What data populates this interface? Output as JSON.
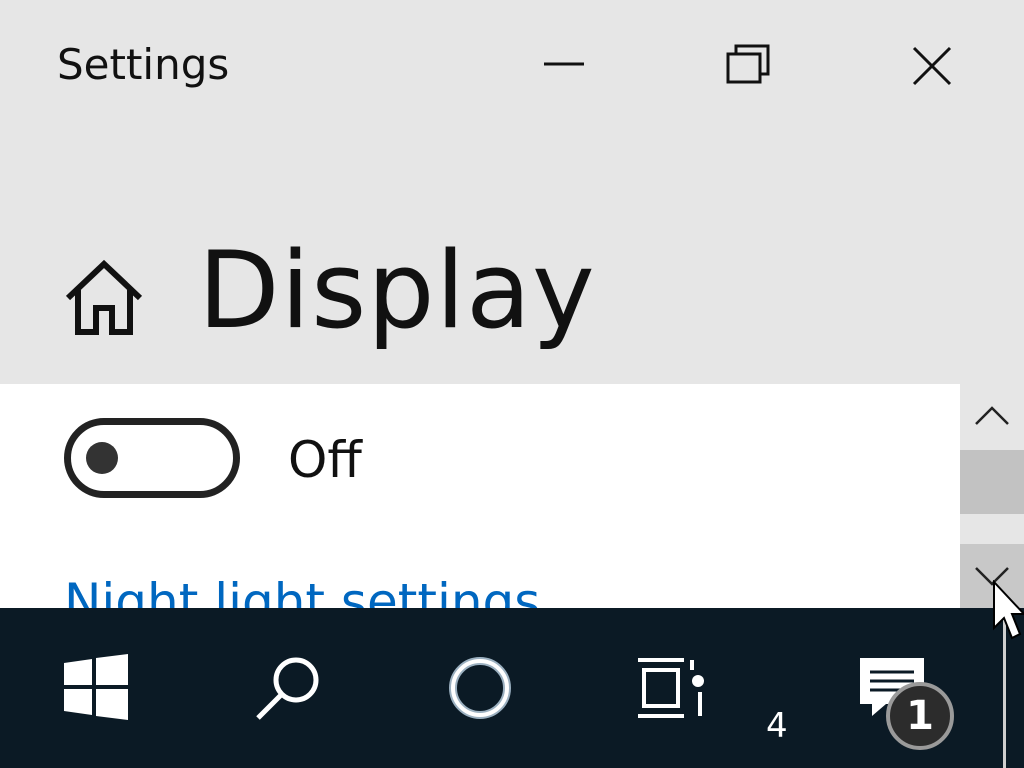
{
  "window": {
    "title": "Settings",
    "controls": {
      "minimize": "minimize-icon",
      "maximize": "restore-icon",
      "close": "close-icon"
    }
  },
  "page": {
    "home_icon": "home-icon",
    "title": "Display"
  },
  "night_light": {
    "toggle_state": "Off",
    "link": "Night light settings"
  },
  "scrollbar": {
    "up_icon": "chevron-up-icon",
    "down_icon": "chevron-down-icon"
  },
  "taskbar": {
    "items": [
      "windows-start-icon",
      "search-icon",
      "cortana-icon",
      "task-view-icon",
      "action-center-icon"
    ],
    "notification_badge": "1",
    "small_text": "4"
  },
  "colors": {
    "link": "#0067c0",
    "taskbar_bg": "#0b1a25",
    "window_bg": "#e6e6e6"
  }
}
